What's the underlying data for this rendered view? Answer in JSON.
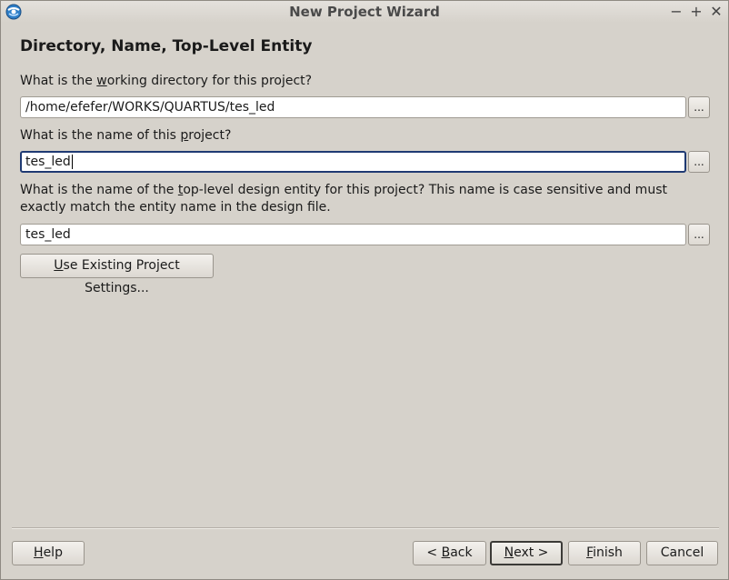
{
  "window": {
    "title": "New Project Wizard",
    "icon": "quartus-globe-icon",
    "controls": {
      "minimize": "−",
      "maximize": "+",
      "close": "✕"
    }
  },
  "page": {
    "heading": "Directory, Name, Top-Level Entity"
  },
  "working_directory": {
    "label_pre": "What is the ",
    "label_key": "w",
    "label_post": "orking directory for this project?",
    "value": "/home/efefer/WORKS/QUARTUS/tes_led",
    "browse_label": "..."
  },
  "project_name": {
    "label_pre": "What is the name of this ",
    "label_key": "p",
    "label_post": "roject?",
    "value": "tes_led",
    "browse_label": "..."
  },
  "top_level_entity": {
    "label_pre": "What is the name of the ",
    "label_key": "t",
    "label_post": "op-level design entity for this project? This name is case sensitive and must exactly match the entity name in the design file.",
    "value": "tes_led",
    "browse_label": "..."
  },
  "existing_settings_button": {
    "key": "U",
    "rest": "se Existing Project Settings..."
  },
  "footer": {
    "help": {
      "key": "H",
      "rest": "elp"
    },
    "back": {
      "pre": "< ",
      "key": "B",
      "rest": "ack"
    },
    "next": {
      "key": "N",
      "rest": "ext >"
    },
    "finish": {
      "key": "F",
      "rest": "inish"
    },
    "cancel": "Cancel"
  },
  "colors": {
    "background": "#d6d2cb",
    "focus_border": "#1f3a73"
  }
}
